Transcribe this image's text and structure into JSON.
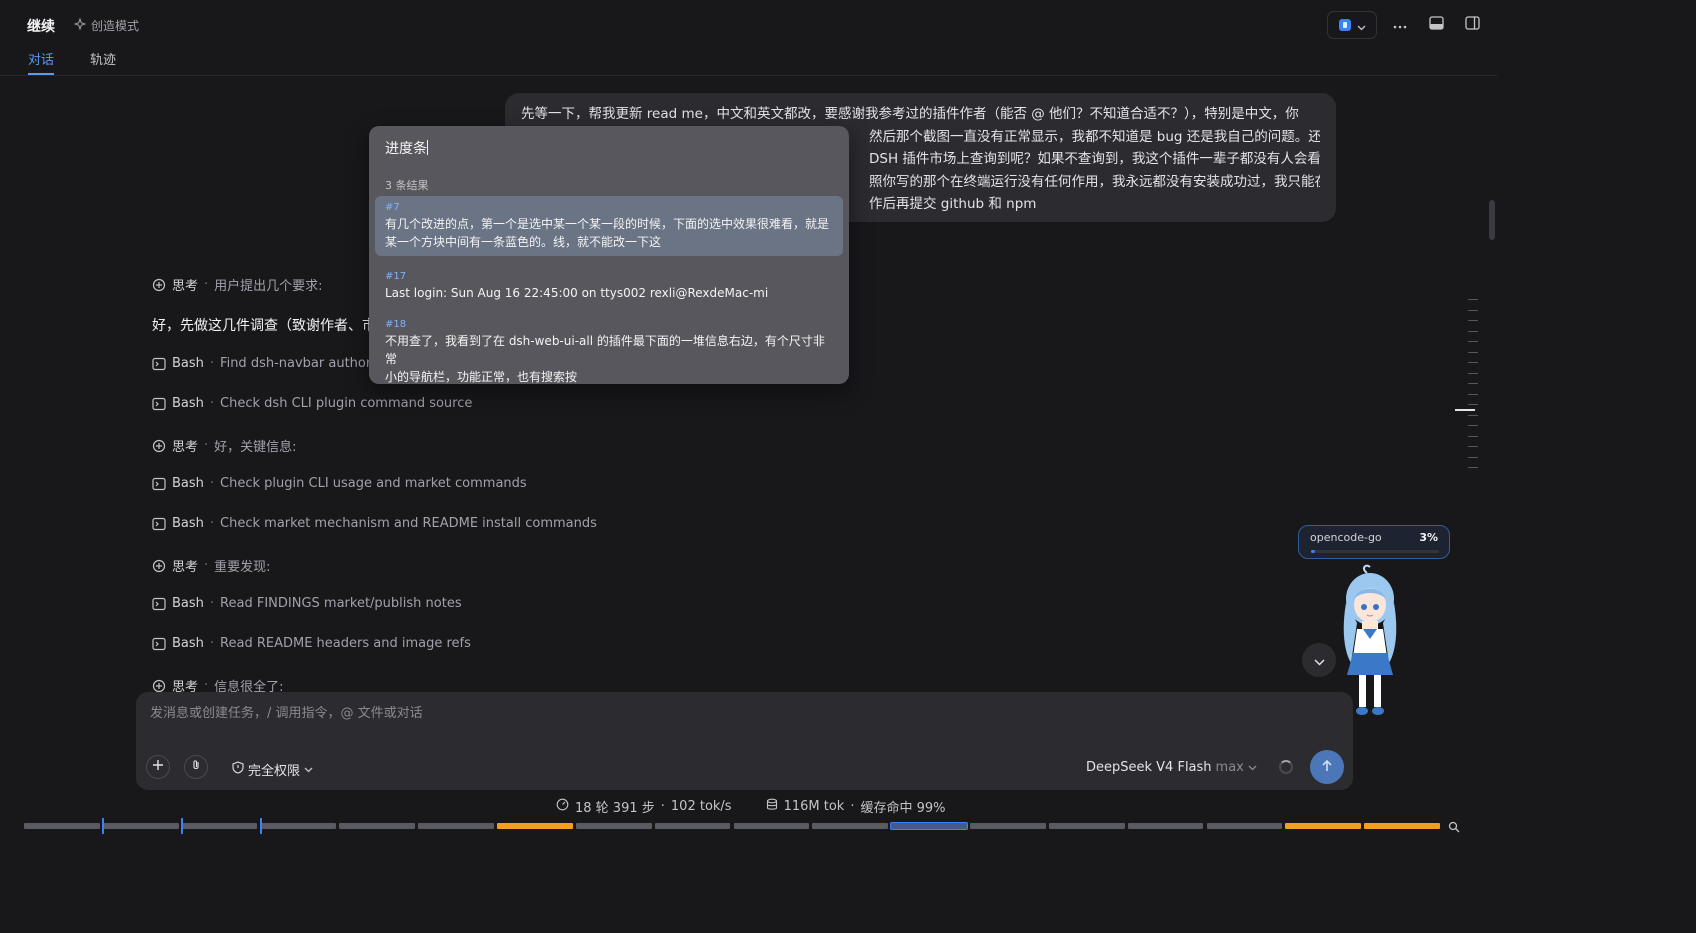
{
  "header": {
    "title": "继续",
    "mode_label": "创造模式",
    "tabs": [
      {
        "label": "对话",
        "active": true
      },
      {
        "label": "轨迹",
        "active": false
      }
    ]
  },
  "message": {
    "lines": [
      "先等一下，帮我更新 read me，中文和英文都改，要感谢我参考过的插件作者（能否 @ 他们？不知道合适不？），特别是中文，你",
      "然后那个截图一直没有正常显示，我都不知道是 bug 还是我自己的问题。还",
      "DSH 插件市场上查询到呢？如果不查询到，我这个插件一辈子都没有人会看",
      "照你写的那个在终端运行没有任何作用，我永远都没有安装成功过，我只能在",
      "作后再提交 github 和 npm"
    ]
  },
  "search_popup": {
    "query": "进度条",
    "count_label": "3 条结果",
    "results": [
      {
        "id": "#7",
        "text_lines": [
          "有几个改进的点，第一个是选中某一个某一段的时候，下面的选中效果很难看，就是",
          "某一个方块中间有一条蓝色的。线，就不能改一下这"
        ],
        "selected": true
      },
      {
        "id": "#17",
        "text_lines": [
          "Last login: Sun Aug 16 22:45:00 on ttys002 rexli@RexdeMac-mi"
        ],
        "selected": false
      },
      {
        "id": "#18",
        "text_lines": [
          "不用查了，我看到了在 dsh-web-ui-all 的插件最下面的一堆信息右边，有个尺寸非常",
          "小的导航栏，功能正常，也有搜索按"
        ],
        "selected": false
      }
    ]
  },
  "activity": [
    {
      "kind": "think",
      "tool": "思考",
      "text": "用户提出几个要求:"
    },
    {
      "kind": "answer",
      "text": "好，先做这几件调查（致谢作者、市"
    },
    {
      "kind": "bash",
      "tool": "Bash",
      "text": "Find dsh-navbar author i"
    },
    {
      "kind": "bash",
      "tool": "Bash",
      "text": "Check dsh CLI plugin command source"
    },
    {
      "kind": "think",
      "tool": "思考",
      "text": "好，关键信息:"
    },
    {
      "kind": "bash",
      "tool": "Bash",
      "text": "Check plugin CLI usage and market commands"
    },
    {
      "kind": "bash",
      "tool": "Bash",
      "text": "Check market mechanism and README install commands"
    },
    {
      "kind": "think",
      "tool": "思考",
      "text": "重要发现:"
    },
    {
      "kind": "bash",
      "tool": "Bash",
      "text": "Read FINDINGS market/publish notes"
    },
    {
      "kind": "bash",
      "tool": "Bash",
      "text": "Read README headers and image refs"
    },
    {
      "kind": "think",
      "tool": "思考",
      "text": "信息很全了:"
    }
  ],
  "usage": {
    "name": "opencode-go",
    "percent_label": "3%",
    "percent": 0.03
  },
  "composer": {
    "placeholder": "发消息或创建任务，/ 调用指令，@ 文件或对话",
    "permission_label": "完全权限",
    "model_label": "DeepSeek V4 Flash",
    "effort_label": "max"
  },
  "stats": {
    "turns": "18 轮 391 步",
    "speed": "102 tok/s",
    "tokens": "116M tok",
    "cache": "缓存命中 99%"
  },
  "timeline": {
    "segments": [
      "gray",
      "gray",
      "gray",
      "gray",
      "gray",
      "gray",
      "orange",
      "gray",
      "gray",
      "gray",
      "gray",
      "blue",
      "gray",
      "gray",
      "gray",
      "gray",
      "orange",
      "orange"
    ]
  },
  "colors": {
    "accent": "#3b82f6",
    "orange": "#f0a020",
    "background": "#18181b"
  }
}
